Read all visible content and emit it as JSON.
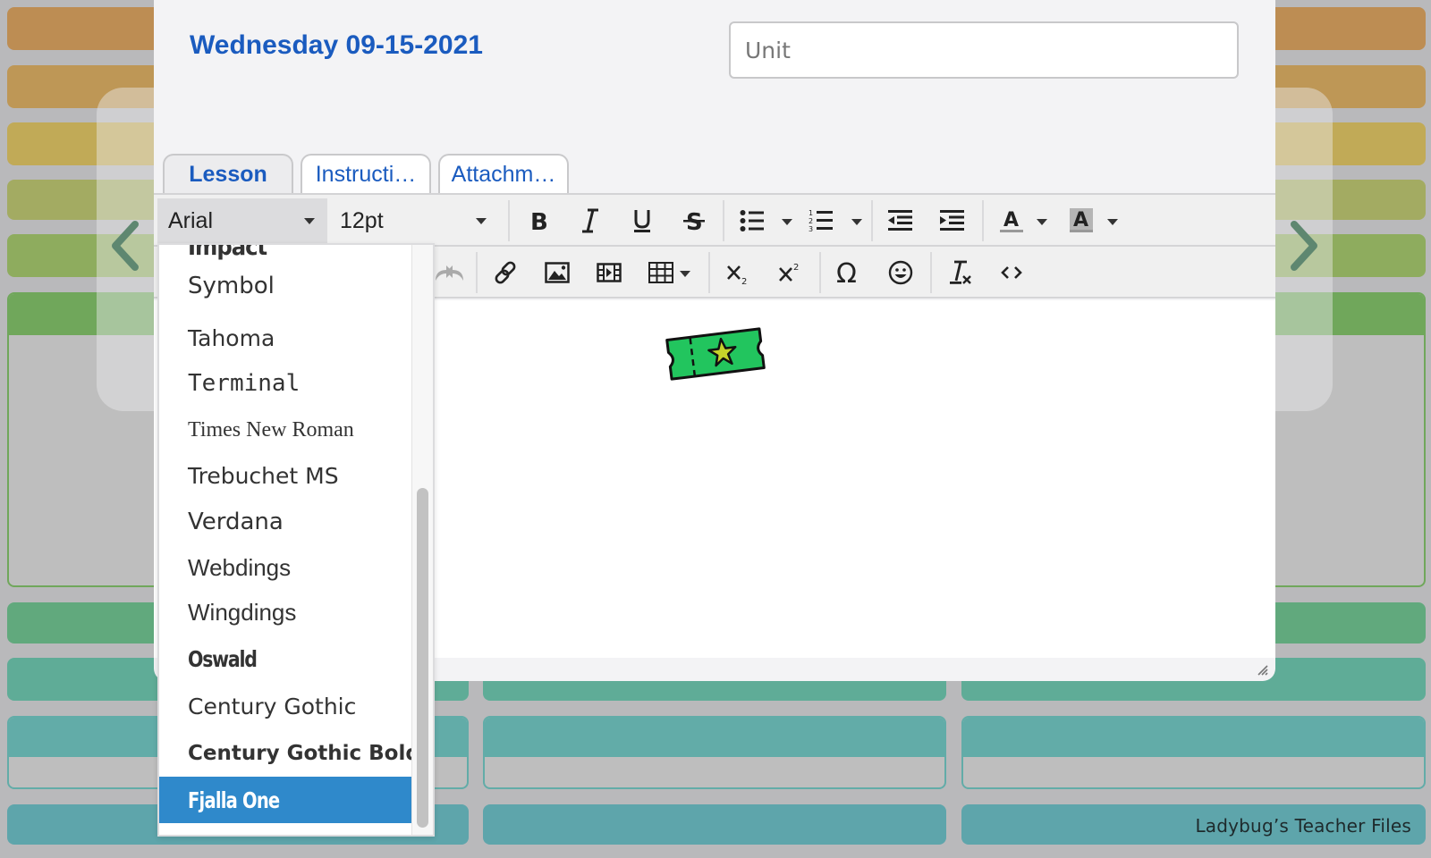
{
  "header": {
    "date_title": "Wednesday 09-15-2021",
    "unit_placeholder": "Unit",
    "unit_value": ""
  },
  "tabs": [
    {
      "label": "Lesson",
      "active": true
    },
    {
      "label": "Instructi…",
      "active": false
    },
    {
      "label": "Attachm…",
      "active": false
    }
  ],
  "toolbar": {
    "font_family": "Arial",
    "font_size": "12pt",
    "row1_buttons": [
      "bold",
      "italic",
      "underline",
      "strikethrough",
      "bullet-list",
      "numbered-list",
      "outdent",
      "indent",
      "text-color",
      "background-color"
    ],
    "row2_buttons": [
      "redo",
      "link",
      "image",
      "media",
      "table",
      "subscript",
      "superscript",
      "special-character",
      "emoticons",
      "clear-formatting",
      "source-code"
    ]
  },
  "font_dropdown": {
    "items": [
      {
        "label": "Impact",
        "style": "impact"
      },
      {
        "label": "Symbol",
        "style": "symbol"
      },
      {
        "label": "Tahoma",
        "style": "tahoma"
      },
      {
        "label": "Terminal",
        "style": "terminal"
      },
      {
        "label": "Times New Roman",
        "style": "times"
      },
      {
        "label": "Trebuchet MS",
        "style": "trebuchet"
      },
      {
        "label": "Verdana",
        "style": "verdana"
      },
      {
        "label": "Webdings",
        "style": "webdings"
      },
      {
        "label": "Wingdings",
        "style": "wingdings"
      },
      {
        "label": "Oswald",
        "style": "oswald"
      },
      {
        "label": "Century Gothic",
        "style": "century"
      },
      {
        "label": "Century Gothic Bold",
        "style": "century-bold"
      },
      {
        "label": "Fjalla One",
        "style": "fjalla",
        "selected": true
      }
    ]
  },
  "content": {
    "image": "ticket-star-clipart"
  },
  "background": {
    "watermark": "Ladybug’s Teacher Files",
    "row_colors": [
      "#bd8d53",
      "#be9756",
      "#c1aa57",
      "#a3ab62",
      "#8eac5e",
      "#70a75b",
      "#61a97d",
      "#5fac97",
      "#62aca8",
      "#5ea5ab"
    ]
  },
  "colors": {
    "accent_blue": "#1a5bbf",
    "selected_item": "#2f89cb",
    "ticket_green": "#22c55e",
    "star_yellow": "#c6d22a"
  }
}
